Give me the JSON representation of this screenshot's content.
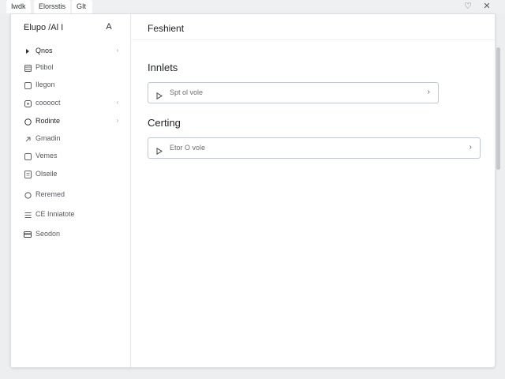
{
  "tabs": [
    {
      "label": "Iwdk"
    },
    {
      "label": "Elorsstis"
    },
    {
      "label": "GIt"
    }
  ],
  "window_controls": {
    "shield": "♡",
    "close": "✕"
  },
  "sidebar": {
    "title": "Elupo /Al I",
    "action": "A",
    "items": [
      {
        "label": "Qnos",
        "icon": "triangle-bullet-icon",
        "chevron": "›",
        "strong": true
      },
      {
        "label": "Ptibol",
        "icon": "grid-icon"
      },
      {
        "label": "Ilegon",
        "icon": "square-icon"
      },
      {
        "label": "cooooct",
        "icon": "rounded-square-icon",
        "chevron": "‹"
      },
      {
        "label": "Rodinte",
        "icon": "circle-icon",
        "chevron": "›",
        "strong": true
      },
      {
        "label": "Gmadin",
        "icon": "link-icon"
      },
      {
        "label": "Vemes",
        "icon": "box-icon"
      },
      {
        "label": "Olseile",
        "icon": "doc-icon"
      },
      {
        "label": "Reremed",
        "icon": "ring-icon"
      },
      {
        "label": "CE Inniatote",
        "icon": "lines-icon"
      },
      {
        "label": "Seodon",
        "icon": "card-icon"
      }
    ]
  },
  "main": {
    "title": "Feshient",
    "sections": [
      {
        "title": "Innlets",
        "row_label": "Spt ol vole",
        "row_chevron": "›"
      },
      {
        "title": "Certing",
        "row_label": "Etor O vole",
        "row_chevron": "›"
      }
    ]
  }
}
